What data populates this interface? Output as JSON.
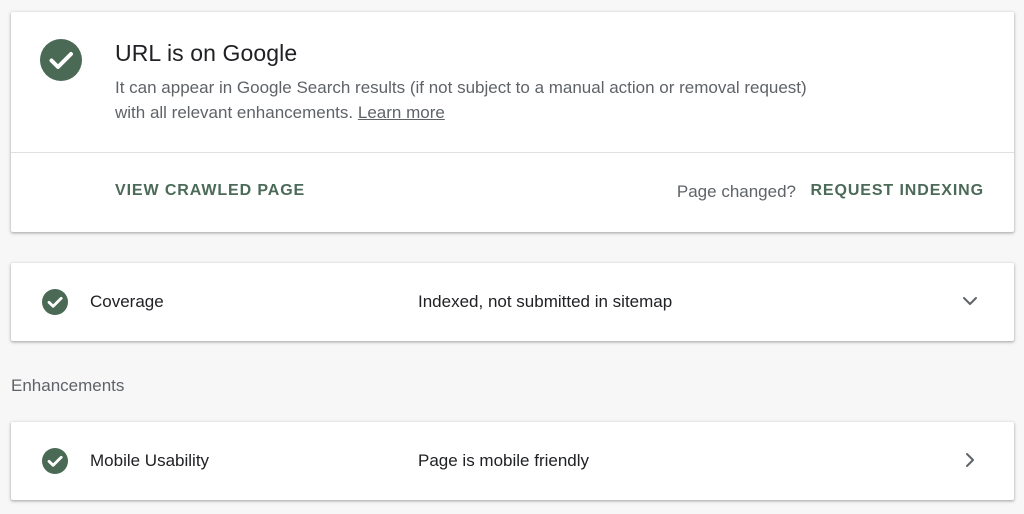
{
  "colors": {
    "success_green": "#4a6a55",
    "action_green": "#4b6a58",
    "text_primary": "#202124",
    "text_secondary": "#5f6368"
  },
  "status": {
    "icon": "check-circle-icon",
    "title": "URL is on Google",
    "description": "It can appear in Google Search results (if not subject to a manual action or removal request) with all relevant enhancements.",
    "learn_more": "Learn more",
    "view_crawled_label": "VIEW CRAWLED PAGE",
    "page_changed_text": "Page changed?",
    "request_indexing_label": "REQUEST INDEXING"
  },
  "coverage": {
    "icon": "check-circle-icon",
    "label": "Coverage",
    "value": "Indexed, not submitted in sitemap",
    "chevron": "chevron-down-icon"
  },
  "enhancements": {
    "heading": "Enhancements",
    "items": [
      {
        "icon": "check-circle-icon",
        "label": "Mobile Usability",
        "value": "Page is mobile friendly",
        "chevron": "chevron-right-icon"
      }
    ]
  }
}
